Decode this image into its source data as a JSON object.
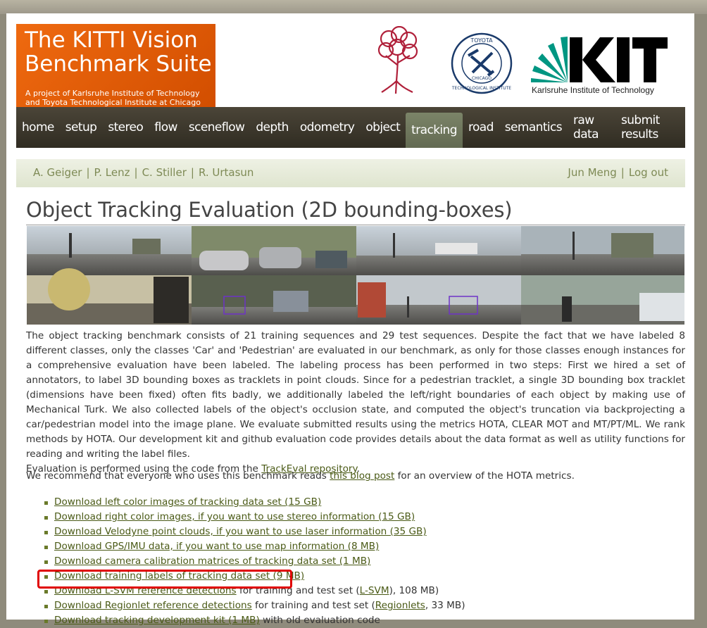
{
  "header": {
    "title_line1": "The KITTI Vision",
    "title_line2": "Benchmark Suite",
    "subtitle_line1": "A project of Karlsruhe Institute of Technology",
    "subtitle_line2": "and Toyota Technological Institute at Chicago",
    "kit_text": "Karlsruhe Institute of Technology",
    "tti_top": "TOYOTA",
    "tti_mid": "CHICAGO",
    "tti_bottom": "TECHNOLOGICAL INSTITUTE"
  },
  "nav": {
    "items": [
      "home",
      "setup",
      "stereo",
      "flow",
      "sceneflow",
      "depth",
      "odometry",
      "object",
      "tracking",
      "road",
      "semantics",
      "raw data",
      "submit results"
    ],
    "active": "tracking"
  },
  "subbar": {
    "authors": [
      "A. Geiger",
      "P. Lenz",
      "C. Stiller",
      "R. Urtasun"
    ],
    "user": "Jun Meng",
    "logout": "Log out"
  },
  "main": {
    "title": "Object Tracking Evaluation (2D bounding-boxes)",
    "description": "The object tracking benchmark consists of 21 training sequences and 29 test sequences. Despite the fact that we have labeled 8 different classes, only the classes 'Car' and 'Pedestrian' are evaluated in our benchmark, as only for those classes enough instances for a comprehensive evaluation have been labeled. The labeling process has been performed in two steps: First we hired a set of annotators, to label 3D bounding boxes as tracklets in point clouds. Since for a pedestrian tracklet, a single 3D bounding box tracklet (dimensions have been fixed) often fits badly, we additionally labeled the left/right boundaries of each object by making use of Mechanical Turk. We also collected labels of the object's occlusion state, and computed the object's truncation via backprojecting a car/pedestrian model into the image plane. We evaluate submitted results using the metrics HOTA, CLEAR MOT and MT/PT/ML. We rank methods by HOTA. Our development kit and github evaluation code provides details about the data format as well as utility functions for reading and writing the label files.",
    "eval_prefix": "Evaluation is performed using the code from the ",
    "eval_link": "TrackEval repository",
    "eval_suffix": ".",
    "recommend_prefix": "We recommend that everyone who uses this benchmark reads ",
    "recommend_link": "this blog post",
    "recommend_suffix": " for an overview of the HOTA metrics."
  },
  "downloads": [
    {
      "link": "Download left color images of tracking data set (15 GB)"
    },
    {
      "link": "Download right color images, if you want to use stereo information (15 GB)"
    },
    {
      "link": "Download Velodyne point clouds, if you want to use laser information (35 GB)"
    },
    {
      "link": "Download GPS/IMU data, if you want to use map information (8 MB)"
    },
    {
      "link": "Download camera calibration matrices of tracking data set (1 MB)"
    },
    {
      "link": "Download training labels of tracking data set (9 MB)"
    },
    {
      "link": "Download L-SVM reference detections",
      "mid": " for training and test set (",
      "link2": "L-SVM",
      "suffix": "), 108 MB)"
    },
    {
      "link": "Download Regionlet reference detections",
      "mid": " for training and test set (",
      "link2": "Regionlets",
      "suffix": ", 33 MB)"
    },
    {
      "link": "Download tracking development kit (1 MB)",
      "mid": " with old evaluation code"
    }
  ]
}
